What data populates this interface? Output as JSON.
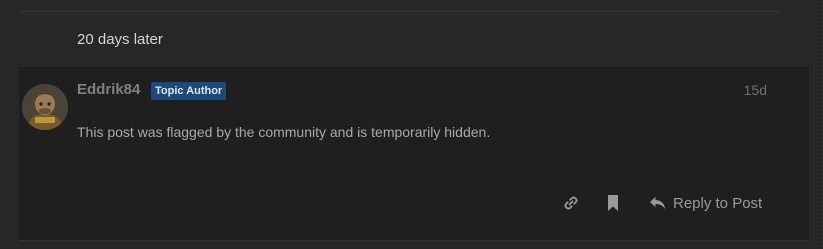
{
  "time_gap": {
    "label": "20 days later"
  },
  "post": {
    "username": "Eddrik84",
    "badge": "Topic Author",
    "date": "15d",
    "body": "This post was flagged by the community and is temporarily hidden.",
    "avatar_icon": "user-avatar"
  },
  "actions": {
    "link_icon": "link-icon",
    "bookmark_icon": "bookmark-icon",
    "reply_icon": "reply-arrow-icon",
    "reply_label": "Reply to Post"
  },
  "colors": {
    "background": "#262626",
    "post_background": "#1f1f1f",
    "badge_background": "#1c4a7a",
    "text_muted": "#808080"
  }
}
